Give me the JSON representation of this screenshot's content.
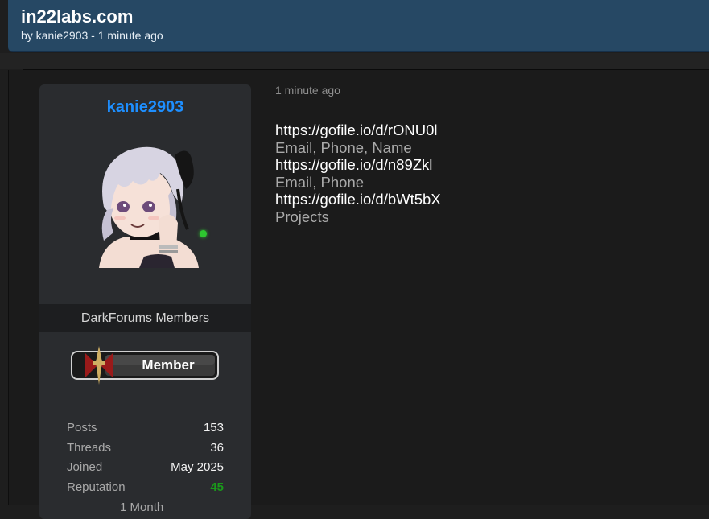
{
  "thread": {
    "title": "in22labs.com",
    "meta": "by kanie2903 - 1 minute ago"
  },
  "post": {
    "time": "1 minute ago",
    "lines": [
      {
        "kind": "link",
        "text": "https://gofile.io/d/rONU0l"
      },
      {
        "kind": "desc",
        "text": "Email, Phone, Name"
      },
      {
        "kind": "link",
        "text": "https://gofile.io/d/n89Zkl"
      },
      {
        "kind": "desc",
        "text": "Email, Phone"
      },
      {
        "kind": "link",
        "text": "https://gofile.io/d/bWt5bX"
      },
      {
        "kind": "desc",
        "text": "Projects"
      }
    ]
  },
  "author": {
    "username": "kanie2903",
    "group": "DarkForums Members",
    "status": "online",
    "badge_label": "Member",
    "stats": [
      {
        "label": "Posts",
        "value": "153"
      },
      {
        "label": "Threads",
        "value": "36"
      },
      {
        "label": "Joined",
        "value": "May 2025"
      },
      {
        "label": "Reputation",
        "value": "45"
      }
    ],
    "partial_line": "1 Month"
  },
  "colors": {
    "header_bg": "#264864",
    "username": "#1e8fff",
    "online": "#2ec630",
    "reputation": "#1a9a1a"
  },
  "icons": {
    "online": "online-status-dot",
    "badge": "member-rank-badge",
    "avatar": "user-avatar"
  }
}
